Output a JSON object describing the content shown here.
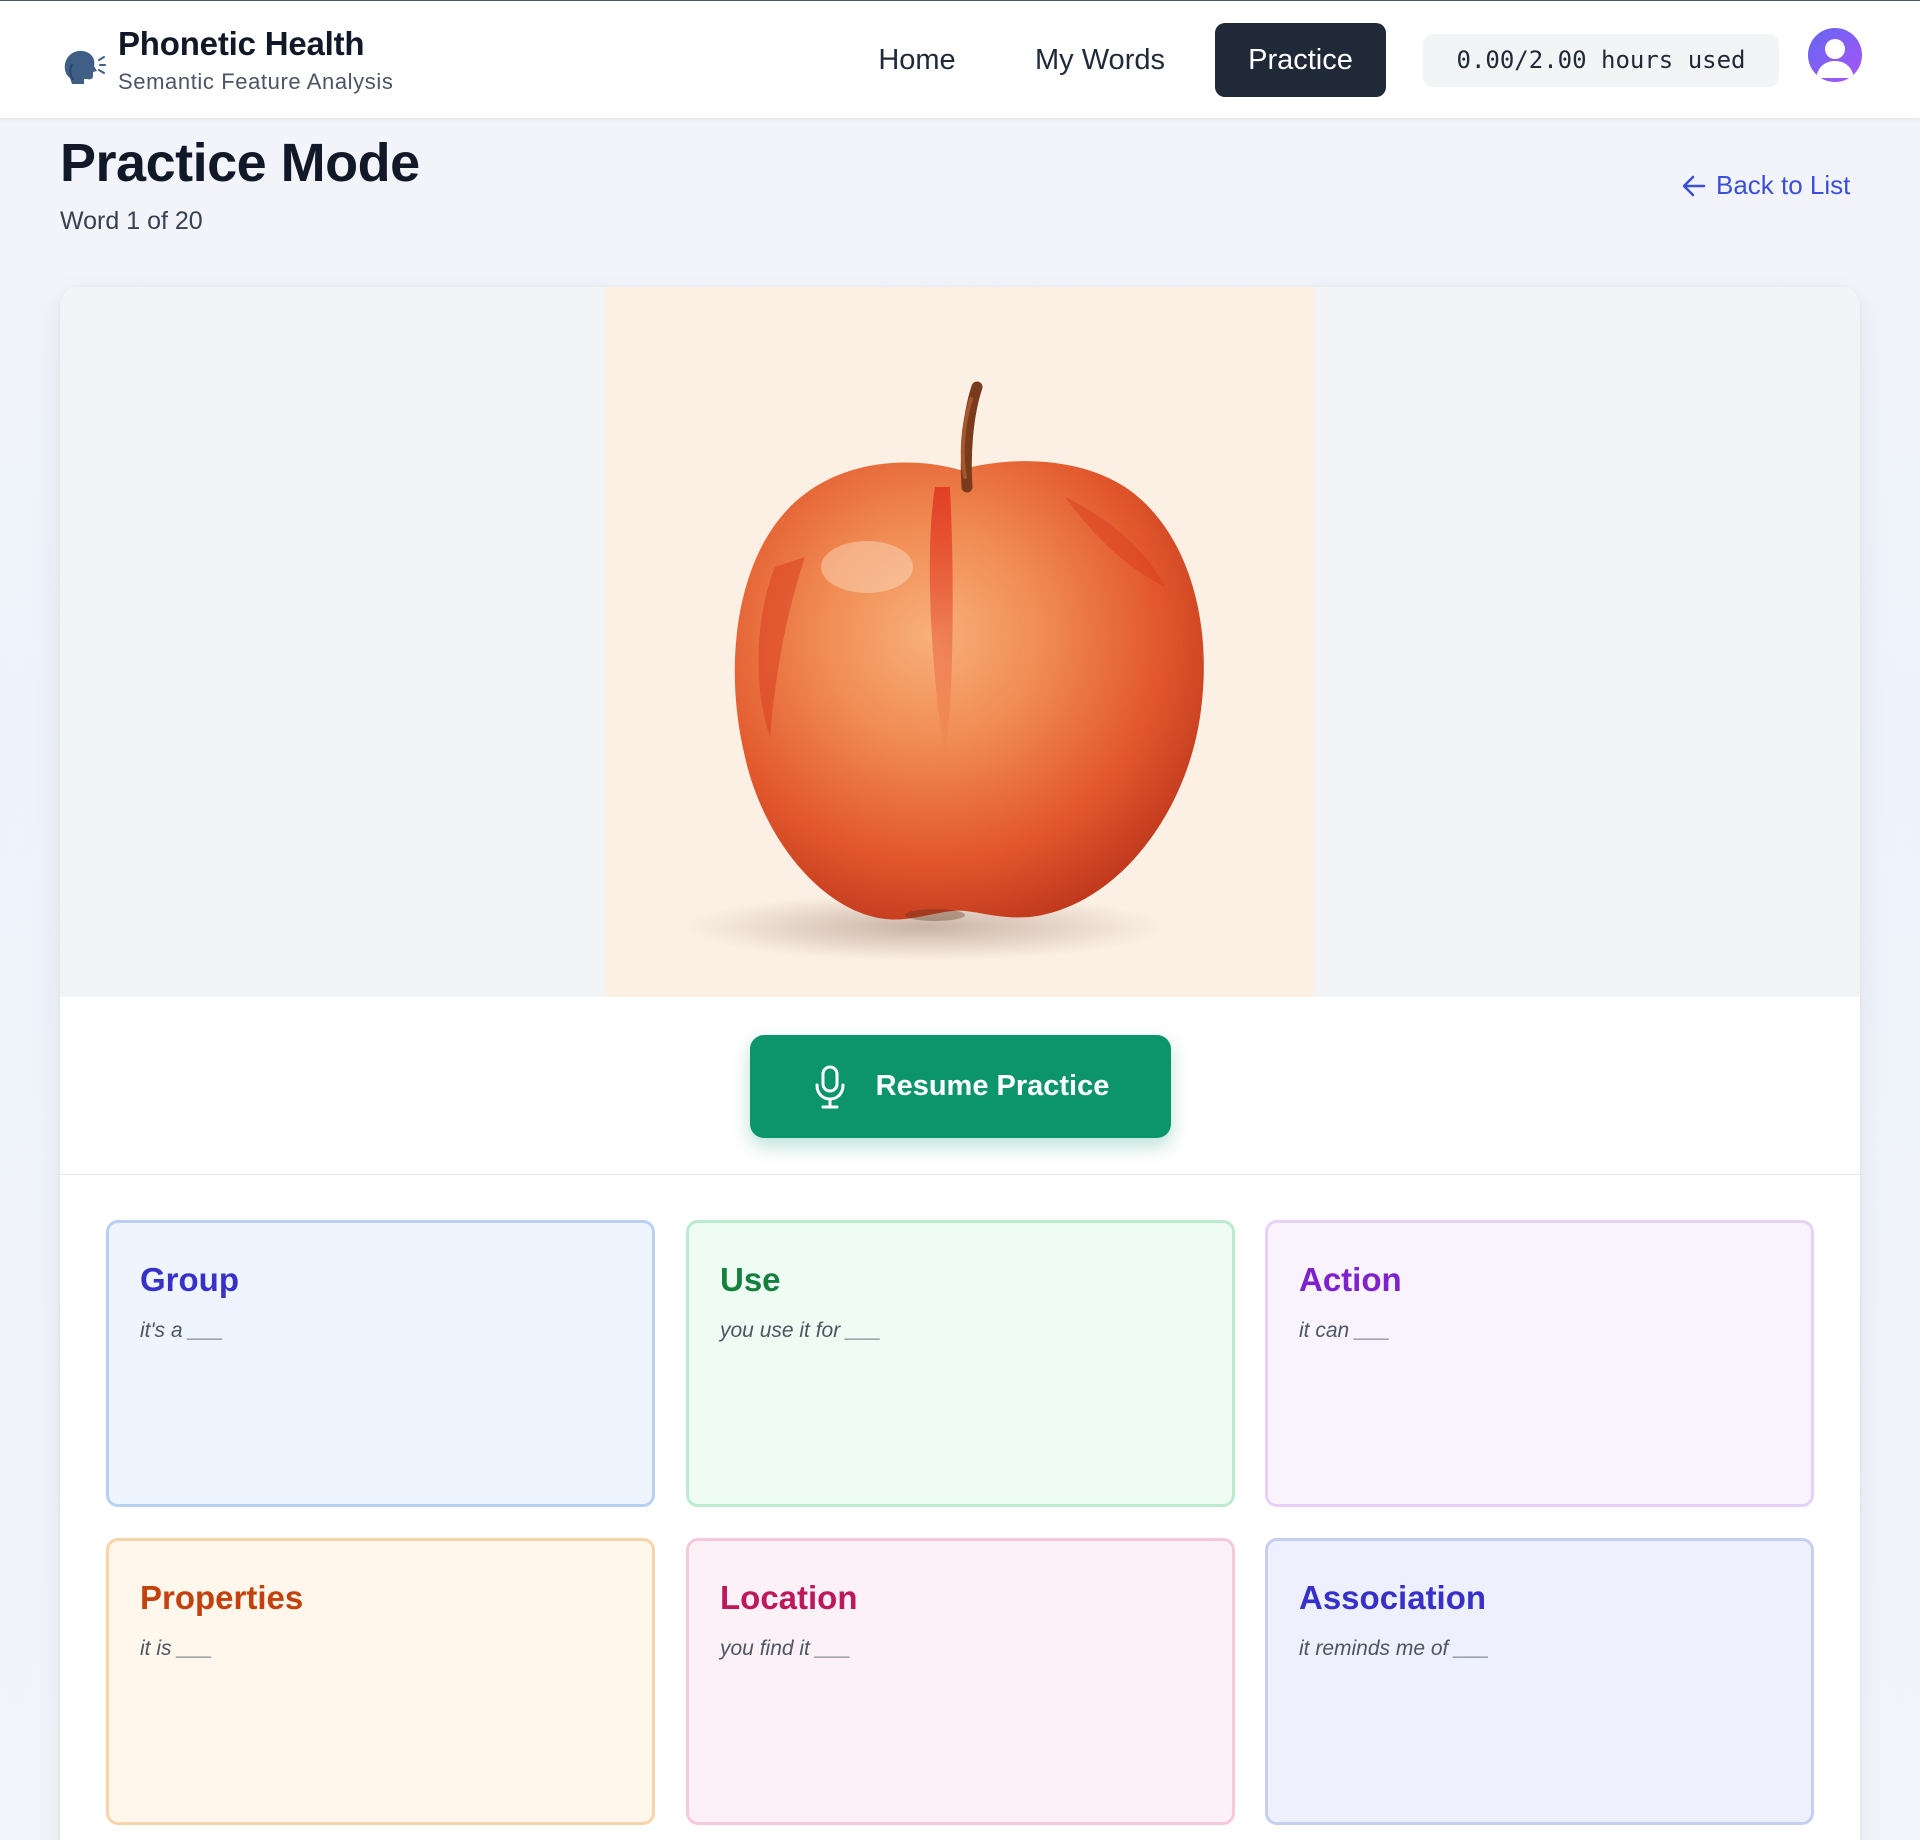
{
  "header": {
    "brand_title": "Phonetic Health",
    "brand_subtitle": "Semantic Feature Analysis",
    "brand_icon": "speaking-head-icon",
    "nav": {
      "home": "Home",
      "my_words": "My Words",
      "practice": "Practice"
    },
    "active_nav": "Practice",
    "usage": "0.00/2.00 hours used",
    "avatar_icon": "user-avatar-icon"
  },
  "page": {
    "title": "Practice Mode",
    "progress": "Word 1 of 20",
    "back_link": "Back to List"
  },
  "practice": {
    "image_subject": "apple",
    "resume_label": "Resume Practice",
    "resume_icon": "microphone-icon",
    "resume_color": "#0c956a"
  },
  "features": [
    {
      "title": "Group",
      "prompt": "it's a ___",
      "title_color": "#3730c9",
      "border": "#b9cff3",
      "bg": "#eff5fe"
    },
    {
      "title": "Use",
      "prompt": "you use it for ___",
      "title_color": "#15803d",
      "border": "#bcebcf",
      "bg": "#eefcf3"
    },
    {
      "title": "Action",
      "prompt": "it can ___",
      "title_color": "#7e22ce",
      "border": "#e6d2f6",
      "bg": "#f9f3fe"
    },
    {
      "title": "Properties",
      "prompt": "it is ___",
      "title_color": "#c2410c",
      "border": "#f8d5a8",
      "bg": "#fff6ec"
    },
    {
      "title": "Location",
      "prompt": "you find it ___",
      "title_color": "#be185d",
      "border": "#f6c8dd",
      "bg": "#fcf1f7"
    },
    {
      "title": "Association",
      "prompt": "it reminds me of ___",
      "title_color": "#3730c9",
      "border": "#c5cff2",
      "bg": "#eef1fd"
    }
  ]
}
